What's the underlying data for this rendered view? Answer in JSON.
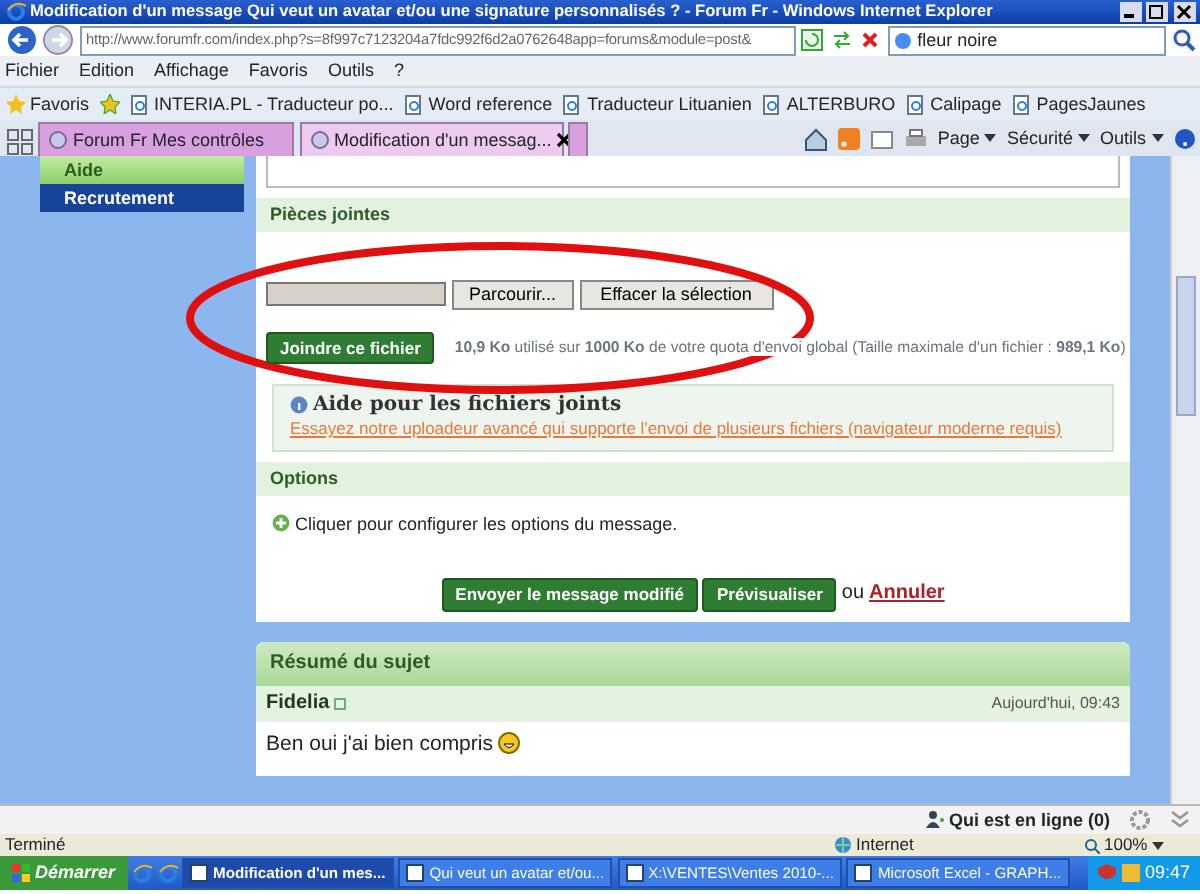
{
  "window": {
    "title": "Modification d'un message Qui veut un avatar et/ou une signature personnalisés ? - Forum Fr - Windows Internet Explorer"
  },
  "nav": {
    "address": "http://www.forumfr.com/index.php?s=8f997c7123204a7fdc992f6d2a0762648app=forums&module=post&",
    "search": "fleur noire"
  },
  "menu": [
    "Fichier",
    "Edition",
    "Affichage",
    "Favoris",
    "Outils",
    "?"
  ],
  "favorites": {
    "label": "Favoris",
    "links": [
      "INTERIA.PL - Traducteur po...",
      "Word reference",
      "Traducteur Lituanien",
      "ALTERBURO",
      "Calipage",
      "PagesJaunes"
    ]
  },
  "tabs": [
    {
      "label": "Forum Fr Mes contrôles",
      "selected": false
    },
    {
      "label": "Modification d'un messag...",
      "selected": true
    }
  ],
  "command_bar": [
    "Page",
    "Sécurité",
    "Outils"
  ],
  "sidebar": [
    {
      "label": "Aide",
      "selected": true
    },
    {
      "label": "Recrutement",
      "selected": false
    }
  ],
  "attachments": {
    "title": "Pièces jointes",
    "browse": "Parcourir...",
    "clear": "Effacer la sélection",
    "attach": "Joindre ce fichier",
    "quota": "**10,9 Ko** utilisé sur **1000 Ko** de votre quota d'envoi global (Taille maximale d'un fichier : **989,1 Ko**)"
  },
  "help": {
    "title": "Aide pour les fichiers joints",
    "link": "Essayez notre uploadeur avancé qui supporte l'envoi de plusieurs fichiers (navigateur moderne requis)"
  },
  "options": {
    "title": "Options",
    "text": "Cliquer pour configurer les options du message."
  },
  "actions": {
    "submit": "Envoyer le message modifié",
    "preview": "Prévisualiser",
    "or": "ou",
    "cancel": "Annuler"
  },
  "summary": {
    "title": "Résumé du sujet",
    "author": "Fidelia",
    "date": "Aujourd'hui, 09:43",
    "text": "Ben oui j'ai bien compris"
  },
  "online_bar": {
    "label": "Qui est en ligne (0)"
  },
  "status_bar": {
    "status": "Terminé",
    "zone": "Internet",
    "zoom": "100%"
  },
  "taskbar": {
    "start": "Démarrer",
    "items": [
      {
        "label": "Modification d'un mes...",
        "selected": true
      },
      {
        "label": "Qui veut un avatar et/ou...",
        "selected": false
      },
      {
        "label": "X:\\VENTES\\Ventes 2010-...",
        "selected": false
      },
      {
        "label": "Microsoft Excel - GRAPH...",
        "selected": false
      }
    ],
    "clock": "09:47"
  }
}
